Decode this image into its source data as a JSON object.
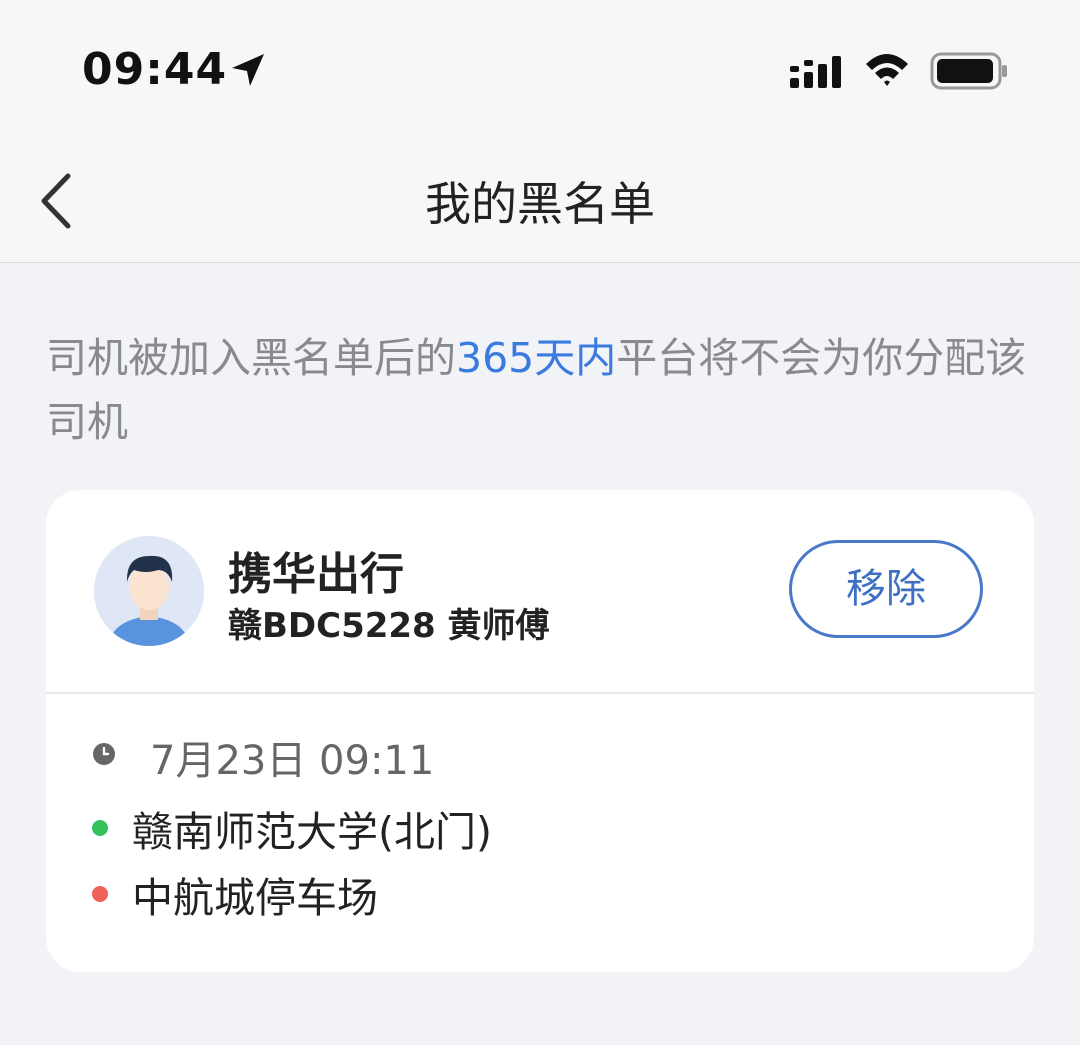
{
  "status_bar": {
    "time": "09:44"
  },
  "header": {
    "title": "我的黑名单"
  },
  "notice": {
    "text_before": "司机被加入黑名单后的",
    "highlight": "365天内",
    "text_after": "平台将不会为你分配该司机"
  },
  "blacklist": [
    {
      "company": "携华出行",
      "driver_info": "赣BDC5228 黄师傅",
      "remove_label": "移除",
      "time": "7月23日 09:11",
      "origin": "赣南师范大学(北门)",
      "destination": "中航城停车场"
    }
  ],
  "colors": {
    "accent": "#3a7be0",
    "button_border": "#4a78c9",
    "origin_dot": "#34c05a",
    "destination_dot": "#f0605a",
    "background": "#f2f3f7"
  }
}
